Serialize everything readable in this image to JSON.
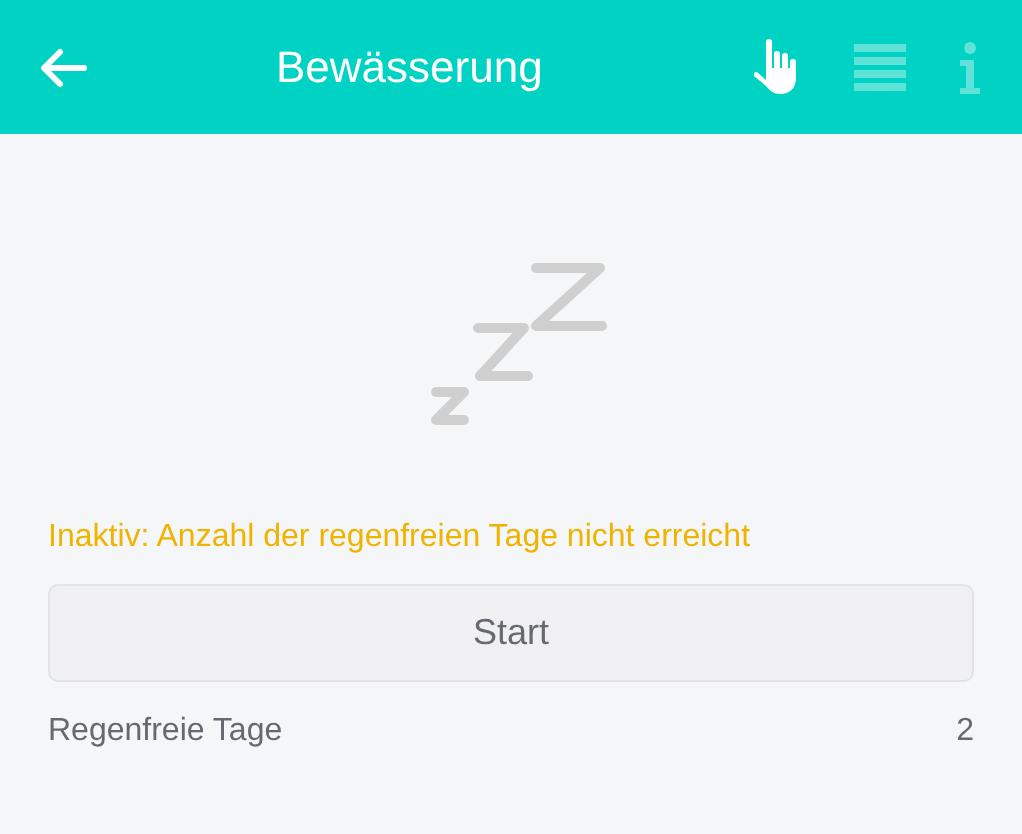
{
  "header": {
    "title": "Bewässerung"
  },
  "toolbar": [
    {
      "kind": "manual",
      "selected": true
    },
    {
      "kind": "list",
      "selected": false
    },
    {
      "kind": "info",
      "selected": false
    }
  ],
  "status": {
    "text": "Inaktiv: Anzahl der regenfreien Tage nicht erreicht",
    "kind": "warning"
  },
  "start_button": {
    "label": "Start"
  },
  "rows": [
    {
      "label": "Regenfreie Tage",
      "value": "2"
    }
  ]
}
